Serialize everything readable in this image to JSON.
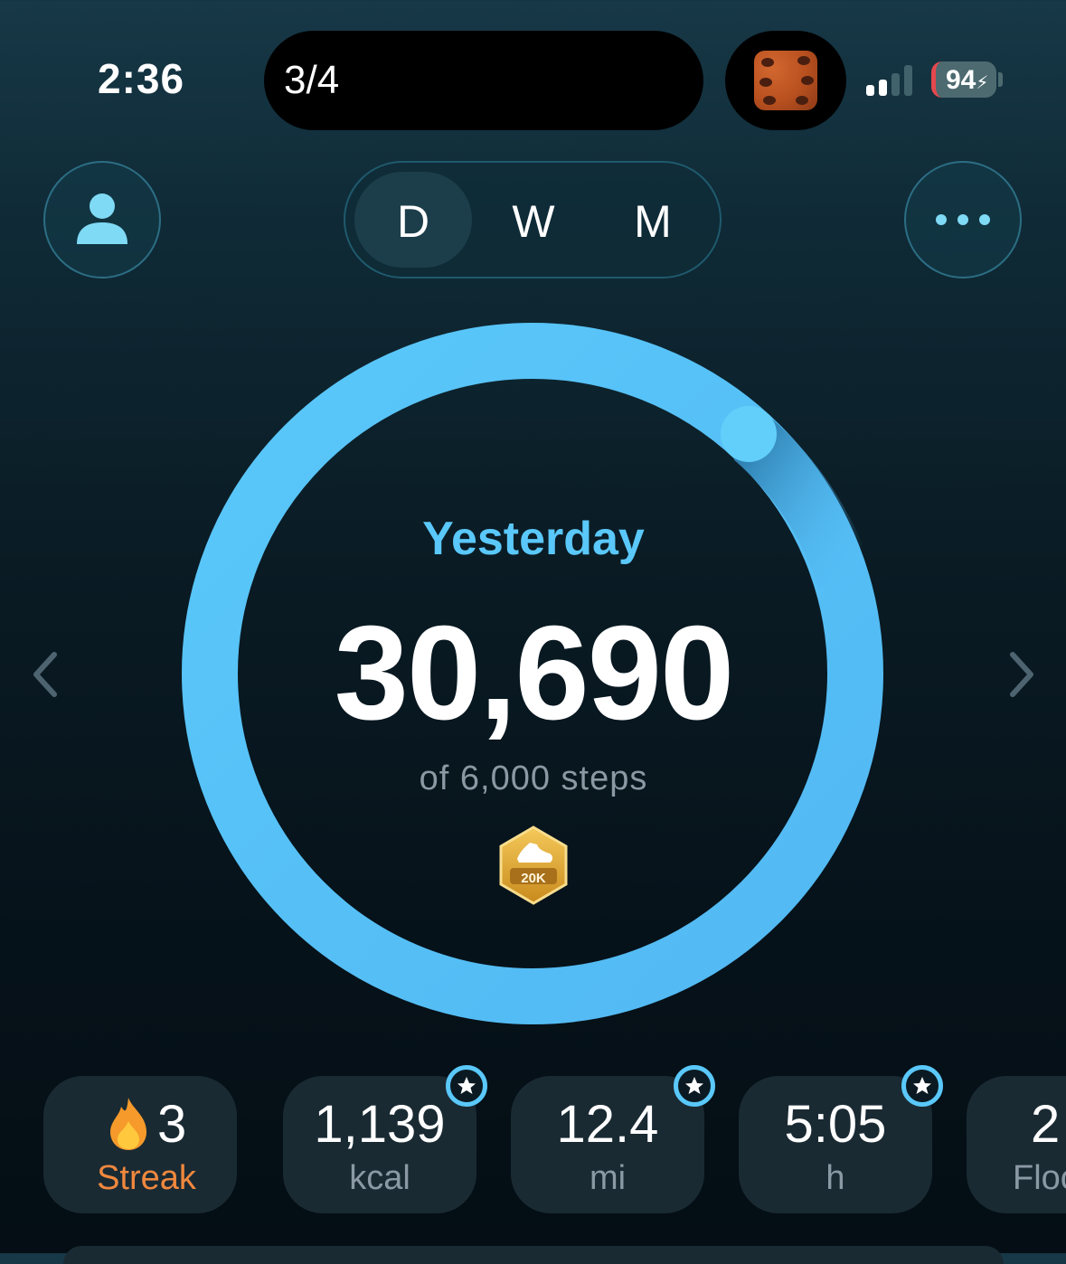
{
  "status_bar": {
    "time": "2:36",
    "island_text": "3/4",
    "battery_level": "94",
    "battery_charging": true
  },
  "header": {
    "profile_icon": "person-icon",
    "more_icon": "ellipsis-icon",
    "segments": [
      {
        "label": "D",
        "active": true
      },
      {
        "label": "W",
        "active": false
      },
      {
        "label": "M",
        "active": false
      }
    ]
  },
  "progress": {
    "period_label": "Yesterday",
    "steps": "30,690",
    "goal_text": "of 6,000 steps",
    "ring_fraction": 1.0,
    "badge_label": "20K",
    "ring_color": "#5ac8fa"
  },
  "stats": [
    {
      "value": "3",
      "unit": "Streak",
      "icon": "flame-icon",
      "starred": false
    },
    {
      "value": "1,139",
      "unit": "kcal",
      "starred": true
    },
    {
      "value": "12.4",
      "unit": "mi",
      "starred": true
    },
    {
      "value": "5:05",
      "unit": "h",
      "starred": true
    },
    {
      "value": "2",
      "unit": "Floors",
      "starred": false
    }
  ],
  "colors": {
    "accent": "#5ac8fa",
    "streak": "#f0883e",
    "badge_gold": "#e0a82e"
  }
}
